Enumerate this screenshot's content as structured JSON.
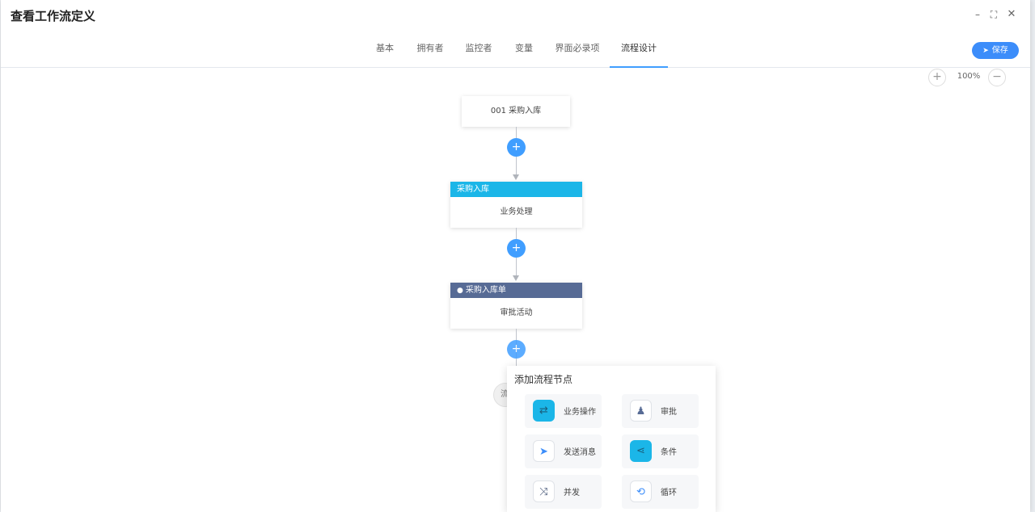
{
  "window": {
    "title": "查看工作流定义"
  },
  "tabs": [
    {
      "label": "基本"
    },
    {
      "label": "拥有者"
    },
    {
      "label": "监控者"
    },
    {
      "label": "变量"
    },
    {
      "label": "界面必录项"
    },
    {
      "label": "流程设计",
      "active": true
    }
  ],
  "toolbar": {
    "save_label": "保存",
    "zoom_level": "100%"
  },
  "flow": {
    "start_node": {
      "label": "001 采购入库"
    },
    "nodes": [
      {
        "header": "采购入库",
        "body": "业务处理",
        "header_color": "#1bb6e8"
      },
      {
        "header": "采购入库单",
        "body": "审批活动",
        "header_color": "#576b95"
      }
    ],
    "end_node": {
      "label": "流"
    }
  },
  "popover": {
    "title": "添加流程节点",
    "options": [
      {
        "label": "业务操作",
        "icon": "exchange-icon"
      },
      {
        "label": "审批",
        "icon": "stamp-icon"
      },
      {
        "label": "发送消息",
        "icon": "send-icon"
      },
      {
        "label": "条件",
        "icon": "share-icon"
      },
      {
        "label": "并发",
        "icon": "shuffle-icon"
      },
      {
        "label": "循环",
        "icon": "loop-icon"
      }
    ]
  },
  "colors": {
    "accent": "#409eff",
    "business_header": "#1bb6e8",
    "approval_header": "#576b95"
  }
}
